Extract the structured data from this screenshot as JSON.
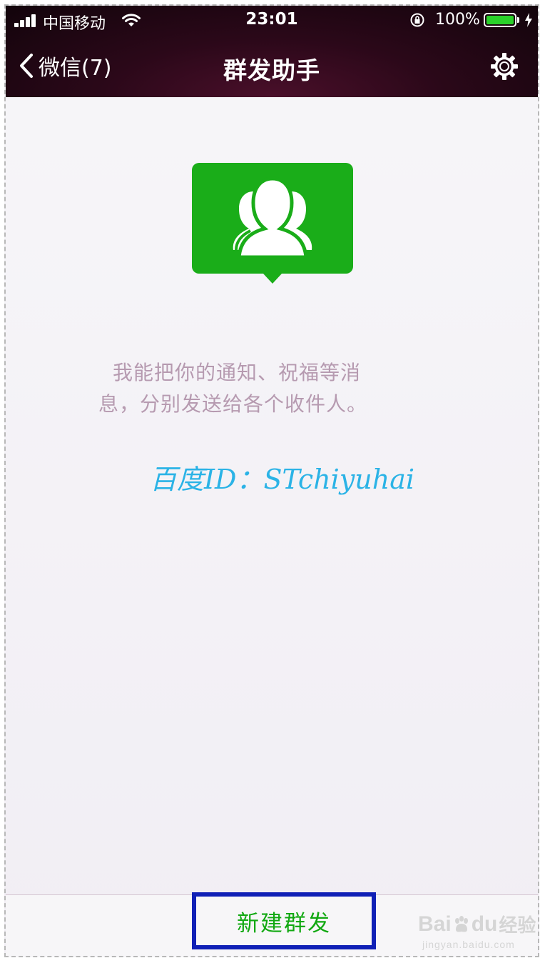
{
  "status_bar": {
    "carrier": "中国移动",
    "time": "23:01",
    "battery_percent": "100%"
  },
  "nav": {
    "back_label": "微信(7)",
    "title": "群发助手"
  },
  "main": {
    "description_line1": "我能把你的通知、祝福等消",
    "description_line2": "息，分别发送给各个收件人。",
    "watermark_text": "百度ID：STchiyuhai"
  },
  "bottom": {
    "new_broadcast_label": "新建群发"
  },
  "baidu_watermark": {
    "brand_left": "Bai",
    "brand_right": "du",
    "product": "经验",
    "url": "jingyan.baidu.com"
  },
  "colors": {
    "accent_green": "#1aad19",
    "header_bg": "#2b0819",
    "description_text": "#b69ab0",
    "watermark_blue": "#2bb3e6",
    "highlight_border": "#1020b6"
  },
  "icons": {
    "back": "chevron-left-icon",
    "settings": "gear-icon",
    "hero": "group-contacts-icon",
    "wifi": "wifi-icon",
    "lock": "orientation-lock-icon",
    "charge": "charging-bolt-icon"
  }
}
